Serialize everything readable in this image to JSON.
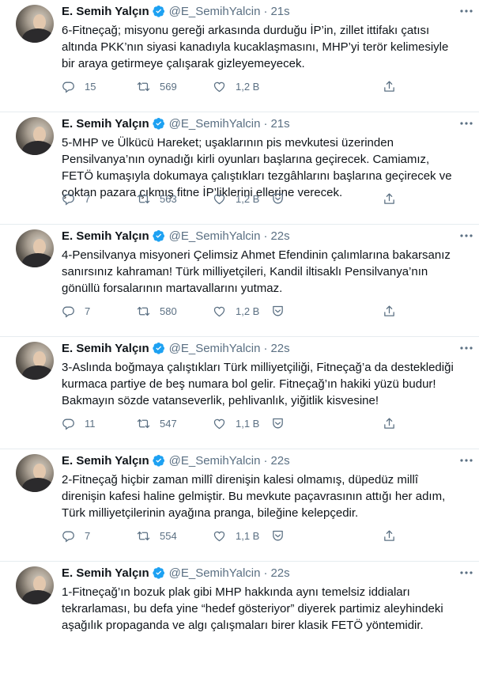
{
  "author": {
    "name": "E. Semih Yalçın",
    "handle": "@E_SemihYalcin"
  },
  "colors": {
    "accent": "#1da1f2",
    "muted": "#5b7083",
    "text": "#0f1419",
    "border": "#e6ecf0"
  },
  "icons": [
    "verified-badge-icon",
    "more-icon",
    "reply-icon",
    "retweet-icon",
    "like-icon",
    "react-icon",
    "share-icon"
  ],
  "tweets": [
    {
      "time": "21s",
      "text": "6-Fitneçağ; misyonu gereği arkasında durduğu İP’in, zillet ittifakı çatısı altında PKK’nın siyasi kanadıyla kucaklaşmasını, MHP’yi terör kelimesiyle bir araya getirmeye çalışarak gizleyemeyecek.",
      "replies": "15",
      "retweets": "569",
      "likes": "1,2 B",
      "has_react": false
    },
    {
      "time": "21s",
      "text": "5-MHP ve Ülkücü Hareket; uşaklarının pis mevkutesi üzerinden Pensilvanya’nın oynadığı kirli oyunları başlarına geçirecek. Camiamız, FETÖ kumaşıyla dokumaya çalıştıkları tezgâhlarını başlarına geçirecek ve çoktan pazara çıkmış fitne İP’liklerini ellerine verecek.",
      "replies": "7",
      "retweets": "563",
      "likes": "1,2 B",
      "has_react": true
    },
    {
      "time": "22s",
      "text": "4-Pensilvanya misyoneri Çelimsiz Ahmet Efendinin çalımlarına bakarsanız sanırsınız kahraman! Türk milliyetçileri, Kandil iltisaklı Pensilvanya’nın gönüllü forsalarının martavallarını yutmaz.",
      "replies": "7",
      "retweets": "580",
      "likes": "1,2 B",
      "has_react": true
    },
    {
      "time": "22s",
      "text": "3-Aslında boğmaya çalıştıkları Türk milliyetçiliği, Fitneçağ’a da desteklediği kurmaca partiye de beş numara bol gelir. Fitneçağ’ın hakiki yüzü budur! Bakmayın sözde vatanseverlik, pehlivanlık, yiğitlik kisvesine!",
      "replies": "11",
      "retweets": "547",
      "likes": "1,1 B",
      "has_react": true
    },
    {
      "time": "22s",
      "text": "2-Fitneçağ hiçbir zaman millî direnişin kalesi olmamış, düpedüz millî direnişin kafesi haline gelmiştir. Bu mevkute paçavrasının attığı her adım, Türk milliyetçilerinin ayağına pranga, bileğine kelepçedir.",
      "replies": "7",
      "retweets": "554",
      "likes": "1,1 B",
      "has_react": true
    },
    {
      "time": "22s",
      "text": "1-Fitneçağ’ın bozuk plak gibi MHP hakkında aynı temelsiz iddiaları tekrarlaması, bu defa yine “hedef gösteriyor” diyerek partimiz aleyhindeki aşağılık propaganda ve algı çalışmaları birer klasik FETÖ yöntemidir.",
      "replies": "",
      "retweets": "",
      "likes": "",
      "has_react": false
    }
  ]
}
